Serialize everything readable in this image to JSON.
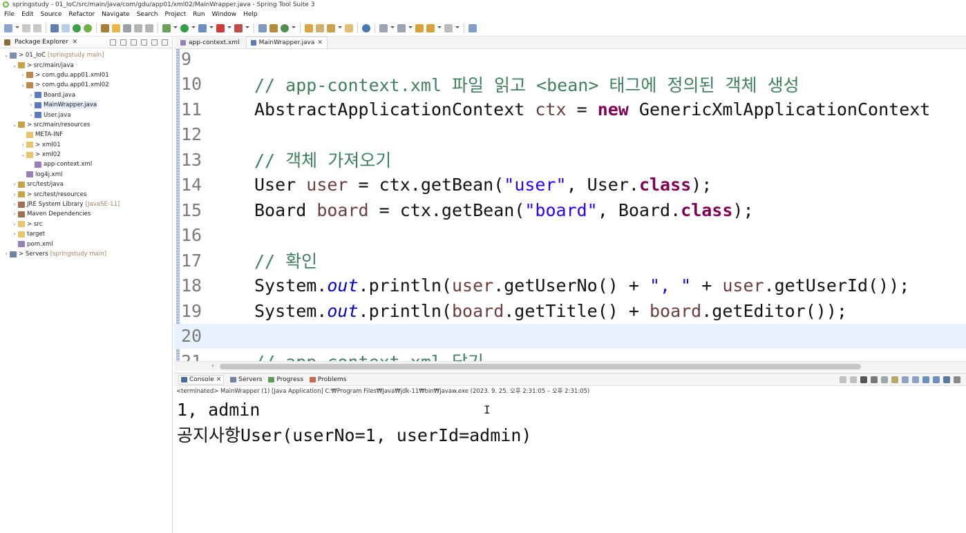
{
  "window": {
    "title": "springstudy - 01_IoC/src/main/java/com/gdu/app01/xml02/MainWrapper.java - Spring Tool Suite 3"
  },
  "menu": [
    "File",
    "Edit",
    "Source",
    "Refactor",
    "Navigate",
    "Search",
    "Project",
    "Run",
    "Window",
    "Help"
  ],
  "package_explorer": {
    "tab_label": "Package Explorer",
    "tree": [
      {
        "name": "tree-project-01-ioc",
        "indent": 0,
        "arrow": "⌄",
        "icon": "project",
        "label": "> 01_IoC",
        "dim": "[springstudy main]"
      },
      {
        "name": "tree-src-main-java",
        "indent": 1,
        "arrow": "⌄",
        "icon": "srcfolder",
        "label": "> src/main/java",
        "dim": ""
      },
      {
        "name": "tree-package-xml01",
        "indent": 2,
        "arrow": "›",
        "icon": "package",
        "label": "> com.gdu.app01.xml01",
        "dim": ""
      },
      {
        "name": "tree-package-xml02",
        "indent": 2,
        "arrow": "⌄",
        "icon": "package",
        "label": "> com.gdu.app01.xml02",
        "dim": ""
      },
      {
        "name": "tree-file-board-java",
        "indent": 3,
        "arrow": "›",
        "icon": "java",
        "label": "Board.java",
        "dim": ""
      },
      {
        "name": "tree-file-mainwrapper-java",
        "indent": 3,
        "arrow": "›",
        "icon": "java",
        "label": "MainWrapper.java",
        "dim": "",
        "selected": true
      },
      {
        "name": "tree-file-user-java",
        "indent": 3,
        "arrow": "›",
        "icon": "java",
        "label": "User.java",
        "dim": ""
      },
      {
        "name": "tree-src-main-resources",
        "indent": 1,
        "arrow": "⌄",
        "icon": "srcfolder",
        "label": "> src/main/resources",
        "dim": ""
      },
      {
        "name": "tree-folder-meta-inf",
        "indent": 2,
        "arrow": "",
        "icon": "folder",
        "label": "META-INF",
        "dim": ""
      },
      {
        "name": "tree-folder-xml01",
        "indent": 2,
        "arrow": "›",
        "icon": "folder",
        "label": "> xml01",
        "dim": ""
      },
      {
        "name": "tree-folder-xml02",
        "indent": 2,
        "arrow": "⌄",
        "icon": "folder",
        "label": "> xml02",
        "dim": ""
      },
      {
        "name": "tree-file-app-context-xml",
        "indent": 3,
        "arrow": "",
        "icon": "xml",
        "label": "app-context.xml",
        "dim": ""
      },
      {
        "name": "tree-file-log4j-xml",
        "indent": 2,
        "arrow": "",
        "icon": "xml",
        "label": "log4j.xml",
        "dim": ""
      },
      {
        "name": "tree-src-test-java",
        "indent": 1,
        "arrow": "›",
        "icon": "srcfolder",
        "label": "src/test/java",
        "dim": ""
      },
      {
        "name": "tree-src-test-resources",
        "indent": 1,
        "arrow": "›",
        "icon": "srcfolder",
        "label": "> src/test/resources",
        "dim": ""
      },
      {
        "name": "tree-jre-library",
        "indent": 1,
        "arrow": "›",
        "icon": "lib",
        "label": "JRE System Library",
        "dim": "[JavaSE-11]"
      },
      {
        "name": "tree-maven-dependencies",
        "indent": 1,
        "arrow": "›",
        "icon": "lib",
        "label": "Maven Dependencies",
        "dim": ""
      },
      {
        "name": "tree-folder-src",
        "indent": 1,
        "arrow": "›",
        "icon": "folder",
        "label": "> src",
        "dim": ""
      },
      {
        "name": "tree-folder-target",
        "indent": 1,
        "arrow": "›",
        "icon": "folder",
        "label": "target",
        "dim": ""
      },
      {
        "name": "tree-file-pom-xml",
        "indent": 1,
        "arrow": "",
        "icon": "xml",
        "label": "pom.xml",
        "dim": ""
      },
      {
        "name": "tree-project-servers",
        "indent": 0,
        "arrow": "›",
        "icon": "server",
        "label": "> Servers",
        "dim": "[springstudy main]"
      }
    ]
  },
  "editor": {
    "tabs": [
      {
        "label": "app-context.xml",
        "active": false
      },
      {
        "label": "MainWrapper.java",
        "active": true
      }
    ],
    "lines": [
      {
        "num": "9",
        "tokens": []
      },
      {
        "num": "10",
        "tokens": [
          {
            "t": "// app-context.xml 파일 읽고 <bean> 태그에 정의된 객체 생성",
            "c": "comment"
          }
        ]
      },
      {
        "num": "11",
        "tokens": [
          {
            "t": "AbstractApplicationContext ",
            "c": "plain"
          },
          {
            "t": "ctx",
            "c": "var"
          },
          {
            "t": " = ",
            "c": "plain"
          },
          {
            "t": "new",
            "c": "kw"
          },
          {
            "t": " GenericXmlApplicationContext",
            "c": "plain"
          }
        ]
      },
      {
        "num": "12",
        "tokens": []
      },
      {
        "num": "13",
        "tokens": [
          {
            "t": "// 객체 가져오기",
            "c": "comment"
          }
        ]
      },
      {
        "num": "14",
        "tokens": [
          {
            "t": "User ",
            "c": "plain"
          },
          {
            "t": "user",
            "c": "var"
          },
          {
            "t": " = ctx.getBean(",
            "c": "plain"
          },
          {
            "t": "\"user\"",
            "c": "str"
          },
          {
            "t": ", User.",
            "c": "plain"
          },
          {
            "t": "class",
            "c": "kw"
          },
          {
            "t": ");",
            "c": "plain"
          }
        ]
      },
      {
        "num": "15",
        "tokens": [
          {
            "t": "Board ",
            "c": "plain"
          },
          {
            "t": "board",
            "c": "var"
          },
          {
            "t": " = ctx.getBean(",
            "c": "plain"
          },
          {
            "t": "\"board\"",
            "c": "str"
          },
          {
            "t": ", Board.",
            "c": "plain"
          },
          {
            "t": "class",
            "c": "kw"
          },
          {
            "t": ");",
            "c": "plain"
          }
        ]
      },
      {
        "num": "16",
        "tokens": []
      },
      {
        "num": "17",
        "tokens": [
          {
            "t": "// 확인",
            "c": "comment"
          }
        ]
      },
      {
        "num": "18",
        "tokens": [
          {
            "t": "System.",
            "c": "plain"
          },
          {
            "t": "out",
            "c": "static"
          },
          {
            "t": ".println(",
            "c": "plain"
          },
          {
            "t": "user",
            "c": "var"
          },
          {
            "t": ".getUserNo() + ",
            "c": "plain"
          },
          {
            "t": "\", \"",
            "c": "str"
          },
          {
            "t": " + ",
            "c": "plain"
          },
          {
            "t": "user",
            "c": "var"
          },
          {
            "t": ".getUserId());",
            "c": "plain"
          }
        ]
      },
      {
        "num": "19",
        "tokens": [
          {
            "t": "System.",
            "c": "plain"
          },
          {
            "t": "out",
            "c": "static"
          },
          {
            "t": ".println(",
            "c": "plain"
          },
          {
            "t": "board",
            "c": "var"
          },
          {
            "t": ".getTitle() + ",
            "c": "plain"
          },
          {
            "t": "board",
            "c": "var"
          },
          {
            "t": ".getEditor());",
            "c": "plain"
          }
        ]
      },
      {
        "num": "20",
        "tokens": [],
        "current": true
      },
      {
        "num": "21",
        "tokens": [
          {
            "t": "// app-context.xml 닫기",
            "c": "comment"
          }
        ]
      }
    ]
  },
  "console": {
    "tabs": [
      "Console",
      "Servers",
      "Progress",
      "Problems"
    ],
    "status": "<terminated> MainWrapper (1) [Java Application] C:₩Program Files₩Java₩jdk-11₩bin₩javaw.exe  (2023. 9. 25. 오후 2:31:05 – 오후 2:31:05)",
    "output": [
      "1, admin",
      "공지사항User(userNo=1, userId=admin)"
    ]
  },
  "colors": {
    "comment": "#3f7f5f",
    "keyword": "#7f0055",
    "string": "#2a00ff",
    "static_field": "#0000c0",
    "local_var": "#6a3e3e",
    "current_line": "#e8f2fe"
  }
}
